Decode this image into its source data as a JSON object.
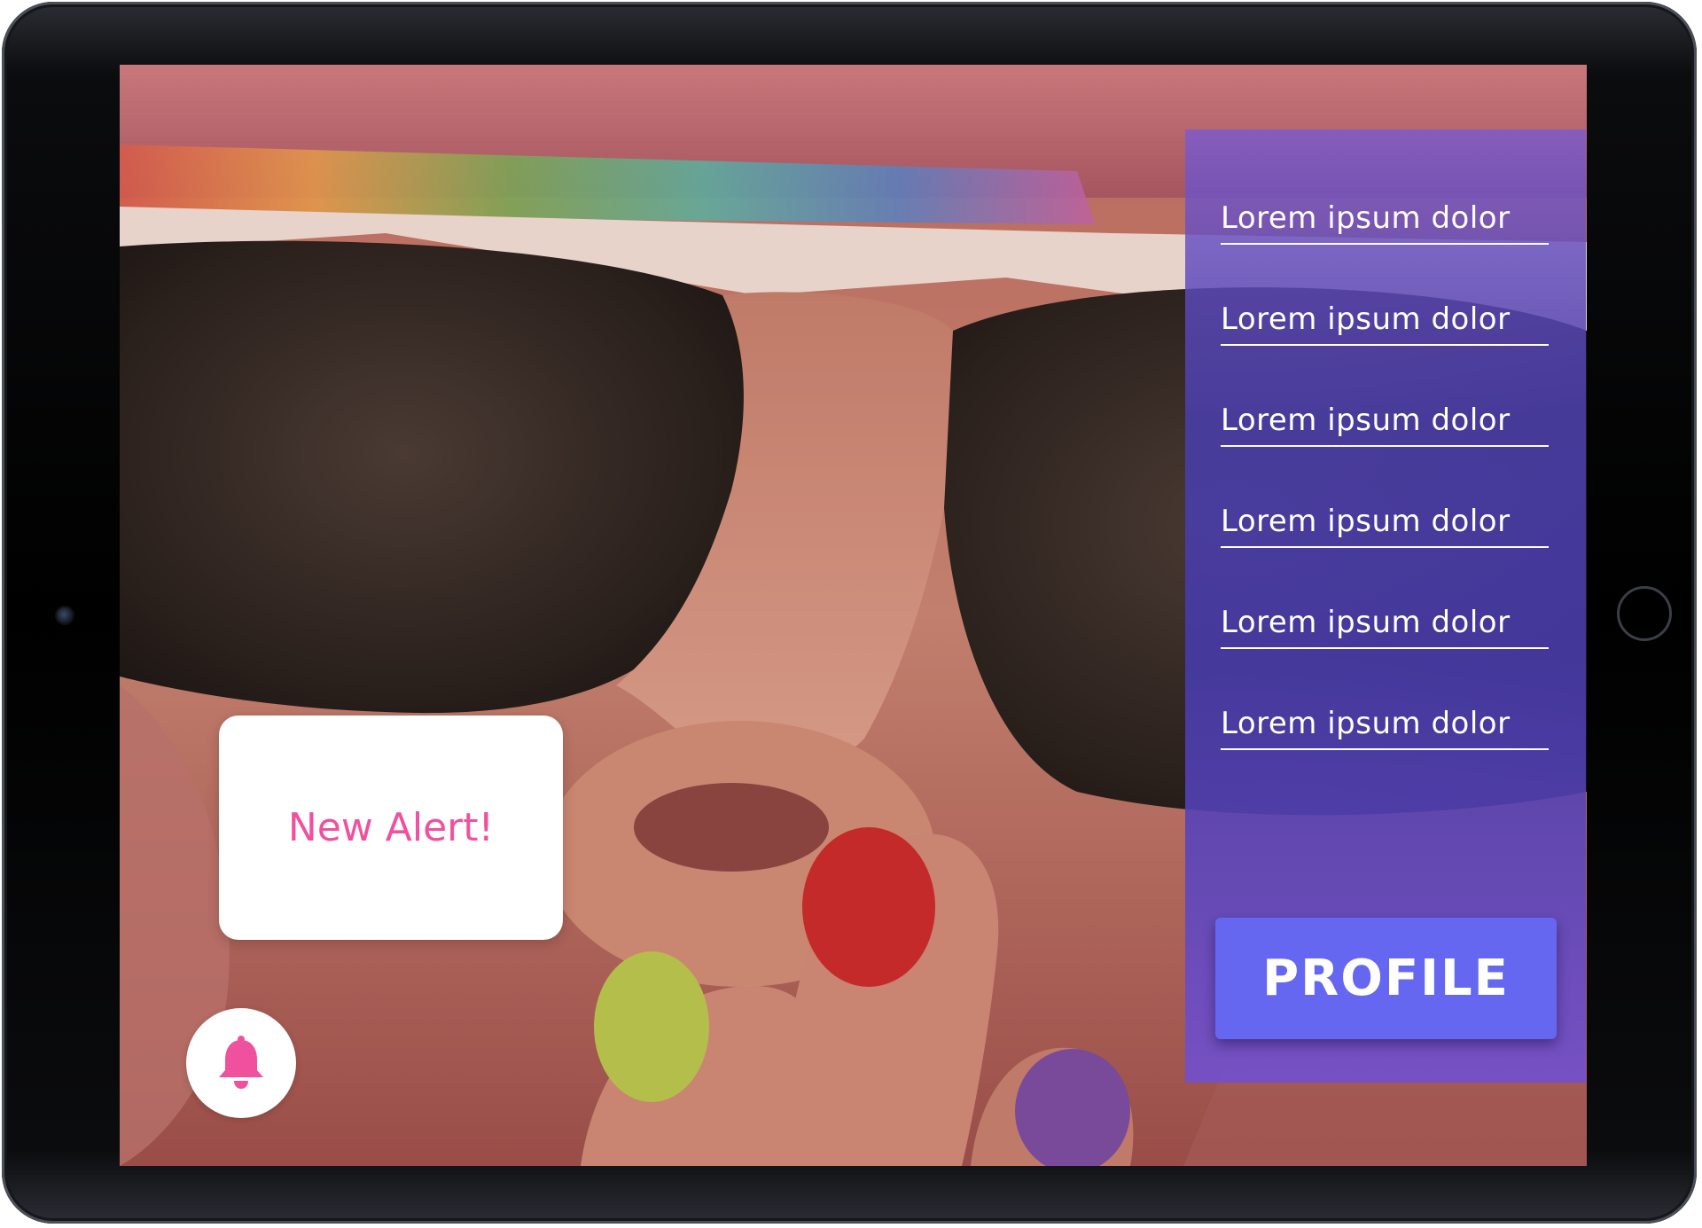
{
  "menu": {
    "items": [
      {
        "label": "Lorem ipsum dolor"
      },
      {
        "label": "Lorem ipsum dolor"
      },
      {
        "label": "Lorem ipsum dolor"
      },
      {
        "label": "Lorem ipsum dolor"
      },
      {
        "label": "Lorem ipsum dolor"
      },
      {
        "label": "Lorem ipsum dolor"
      }
    ]
  },
  "profile_button": {
    "label": "PROFILE"
  },
  "alert": {
    "message": "New Alert!",
    "icon": "bell-icon"
  },
  "colors": {
    "accent": "#6567f0",
    "alert_text": "#f0519e",
    "panel": "#4a3eaa"
  }
}
